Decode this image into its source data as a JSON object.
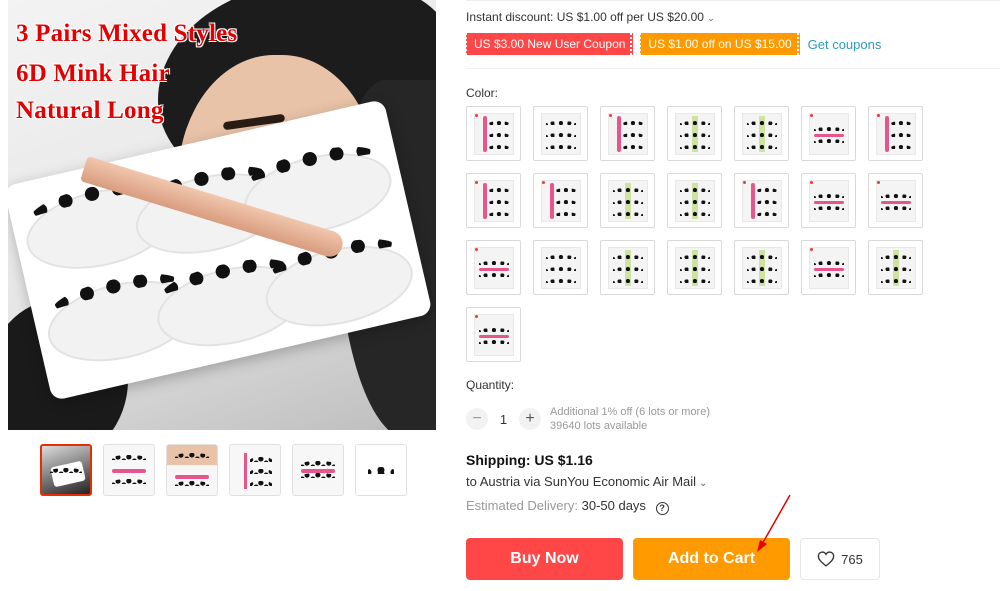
{
  "gallery": {
    "promo_lines": [
      "3 Pairs Mixed Styles",
      "6D Mink Hair",
      "Natural Long"
    ]
  },
  "pricing": {
    "instant_discount": "Instant discount: US $1.00 off per US $20.00",
    "coupons": [
      {
        "label": "US $3.00 New User Coupon",
        "color": "#ff4747"
      },
      {
        "label": "US $1.00 off on US $15.00",
        "color": "#ff9900"
      }
    ],
    "get_coupons": "Get coupons"
  },
  "color": {
    "label": "Color:",
    "options_count": 22
  },
  "quantity": {
    "label": "Quantity:",
    "value": "1",
    "minus": "−",
    "plus": "+",
    "additional": "Additional 1% off (6 lots or more)",
    "available": "39640 lots available"
  },
  "shipping": {
    "title": "Shipping: US $1.16",
    "to": "to Austria via SunYou Economic Air Mail",
    "estimated_label": "Estimated Delivery:",
    "estimated_days": "30-50 days"
  },
  "actions": {
    "buy_now": "Buy Now",
    "add_to_cart": "Add to Cart",
    "wishlist_count": "765"
  },
  "colors": {
    "accent_red": "#ff4747",
    "accent_orange": "#ff9a00",
    "link_blue": "#2e9cc3",
    "annotation_arrow": "#e60000"
  },
  "icons": [
    "chevron-down-icon",
    "help-circle-icon",
    "heart-icon"
  ]
}
